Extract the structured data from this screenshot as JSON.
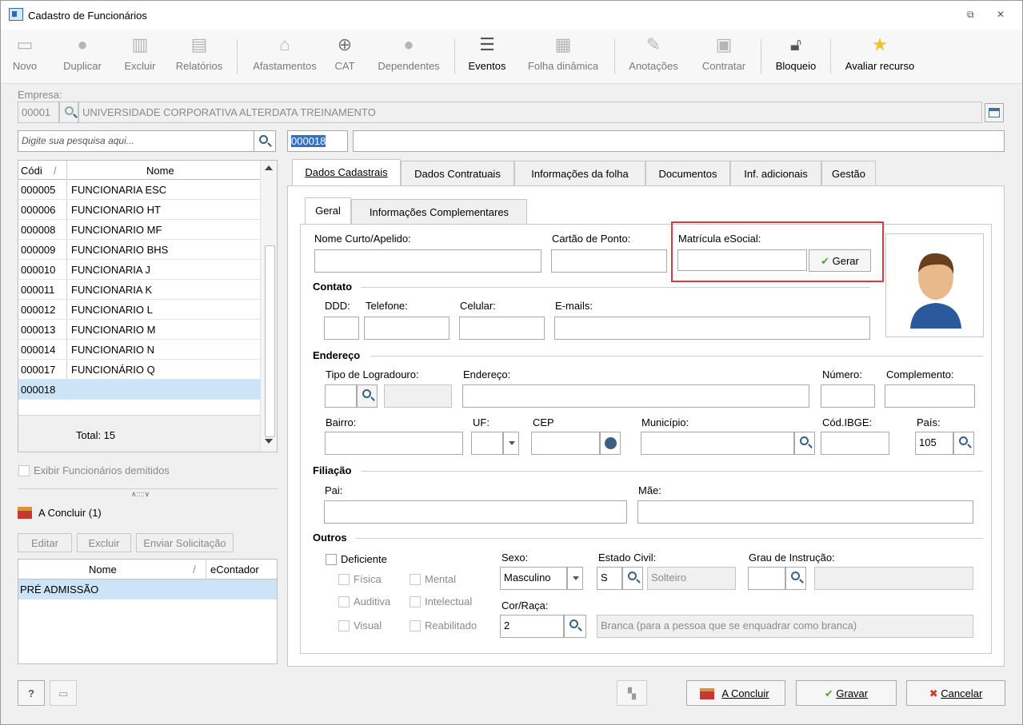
{
  "window": {
    "title": "Cadastro de Funcionários",
    "restore": "⧉",
    "close": "✕"
  },
  "toolbar": {
    "items": [
      {
        "label": "Novo"
      },
      {
        "label": "Duplicar"
      },
      {
        "label": "Excluir"
      },
      {
        "label": "Relatórios"
      },
      {
        "label": "Afastamentos"
      },
      {
        "label": "CAT"
      },
      {
        "label": "Dependentes"
      },
      {
        "label": "Eventos"
      },
      {
        "label": "Folha dinâmica"
      },
      {
        "label": "Anotações"
      },
      {
        "label": "Contratar"
      },
      {
        "label": "Bloqueio"
      },
      {
        "label": "Avaliar recurso"
      }
    ]
  },
  "empresa": {
    "label": "Empresa:",
    "code": "00001",
    "name": "UNIVERSIDADE CORPORATIVA ALTERDATA TREINAMENTO"
  },
  "search": {
    "placeholder": "Digite sua pesquisa aqui..."
  },
  "record": {
    "code": "000018",
    "name": ""
  },
  "employees": {
    "col_code": "Códi",
    "col_sort": "/",
    "col_name": "Nome",
    "rows": [
      {
        "code": "000005",
        "name": "FUNCIONARIA ESC"
      },
      {
        "code": "000006",
        "name": "FUNCIONARIO HT"
      },
      {
        "code": "000008",
        "name": "FUNCIONARIO MF"
      },
      {
        "code": "000009",
        "name": "FUNCIONARIO BHS"
      },
      {
        "code": "000010",
        "name": "FUNCIONARIA J"
      },
      {
        "code": "000011",
        "name": "FUNCIONARIA K"
      },
      {
        "code": "000012",
        "name": "FUNCIONARIO L"
      },
      {
        "code": "000013",
        "name": "FUNCIONARIO M"
      },
      {
        "code": "000014",
        "name": "FUNCIONARIO N"
      },
      {
        "code": "000017",
        "name": "FUNCIONÁRIO Q"
      },
      {
        "code": "000018",
        "name": ""
      }
    ],
    "total": "Total: 15"
  },
  "exibir_demitidos": "Exibir Funcionários demitidos",
  "splitter": "∧::::∨",
  "a_concluir": {
    "title": "A Concluir (1)",
    "edit": "Editar",
    "delete": "Excluir",
    "send": "Enviar Solicitação",
    "col_nome": "Nome",
    "col_sort": "/",
    "col_econtador": "eContador",
    "rows": [
      {
        "nome": "PRÉ ADMISSÃO",
        "econtador": ""
      }
    ]
  },
  "tabs": [
    {
      "label": "Dados Cadastrais"
    },
    {
      "label": "Dados Contratuais"
    },
    {
      "label": "Informações da folha"
    },
    {
      "label": "Documentos"
    },
    {
      "label": "Inf. adicionais"
    },
    {
      "label": "Gestão"
    }
  ],
  "subtabs": [
    {
      "label": "Geral"
    },
    {
      "label": "Informações Complementares"
    }
  ],
  "form": {
    "nome_curto": "Nome Curto/Apelido:",
    "cartao_ponto": "Cartão de Ponto:",
    "matricula": "Matrícula eSocial:",
    "gerar": "Gerar",
    "contato": "Contato",
    "ddd": "DDD:",
    "telefone": "Telefone:",
    "celular": "Celular:",
    "emails": "E-mails:",
    "endereco_sec": "Endereço",
    "tipo_logradouro": "Tipo de Logradouro:",
    "endereco": "Endereço:",
    "numero": "Número:",
    "complemento": "Complemento:",
    "bairro": "Bairro:",
    "uf": "UF:",
    "cep": "CEP",
    "municipio": "Município:",
    "cod_ibge": "Cód.IBGE:",
    "pais": "País:",
    "pais_value": "105",
    "filiacao": "Filiação",
    "pai": "Pai:",
    "mae": "Mãe:",
    "outros": "Outros",
    "deficiente": "Deficiente",
    "fisica": "Física",
    "mental": "Mental",
    "auditiva": "Auditiva",
    "intelectual": "Intelectual",
    "visual": "Visual",
    "reabilitado": "Reabilitado",
    "sexo": "Sexo:",
    "sexo_value": "Masculino",
    "estado_civil": "Estado Civil:",
    "ec_code": "S",
    "ec_desc": "Solteiro",
    "grau": "Grau de Instrução:",
    "cor_raca": "Cor/Raça:",
    "cor_code": "2",
    "cor_desc": "Branca (para a pessoa que se enquadrar como branca)"
  },
  "footer": {
    "help": "?",
    "a_concluir": "A Concluir",
    "gravar": "Gravar",
    "cancelar": "Cancelar"
  },
  "colors": {
    "highlight": "#d63b44",
    "selection": "#cce4f7",
    "accent": "#2a6fb0"
  }
}
